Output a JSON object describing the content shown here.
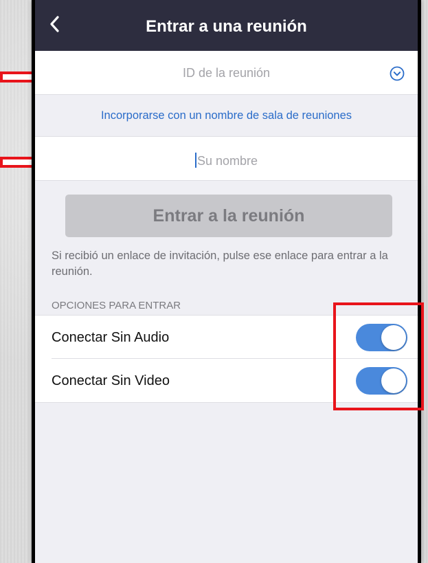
{
  "header": {
    "title": "Entrar a una reunión",
    "back_icon": "chevron-left-icon"
  },
  "meeting_id": {
    "placeholder": "ID de la reunión",
    "value": "",
    "dropdown_icon": "chevron-down-circle-icon"
  },
  "join_with_room_link": "Incorporarse con un nombre de sala de reuniones",
  "name_field": {
    "placeholder": "Su nombre",
    "value": ""
  },
  "join_button": {
    "label": "Entrar a la reunión",
    "enabled": false
  },
  "help_text": "Si recibió un enlace de invitación, pulse ese enlace para entrar a la reunión.",
  "options": {
    "header": "OPCIONES PARA ENTRAR",
    "items": [
      {
        "label": "Conectar Sin Audio",
        "on": true
      },
      {
        "label": "Conectar Sin Video",
        "on": true
      }
    ]
  },
  "colors": {
    "header_bg": "#2d2d3f",
    "link": "#2a6cc9",
    "toggle_on": "#4a89dc",
    "annotation": "#e8141b"
  },
  "annotations": {
    "arrow_icon": "right-arrow-outline-icon",
    "box": "red-rectangle"
  }
}
